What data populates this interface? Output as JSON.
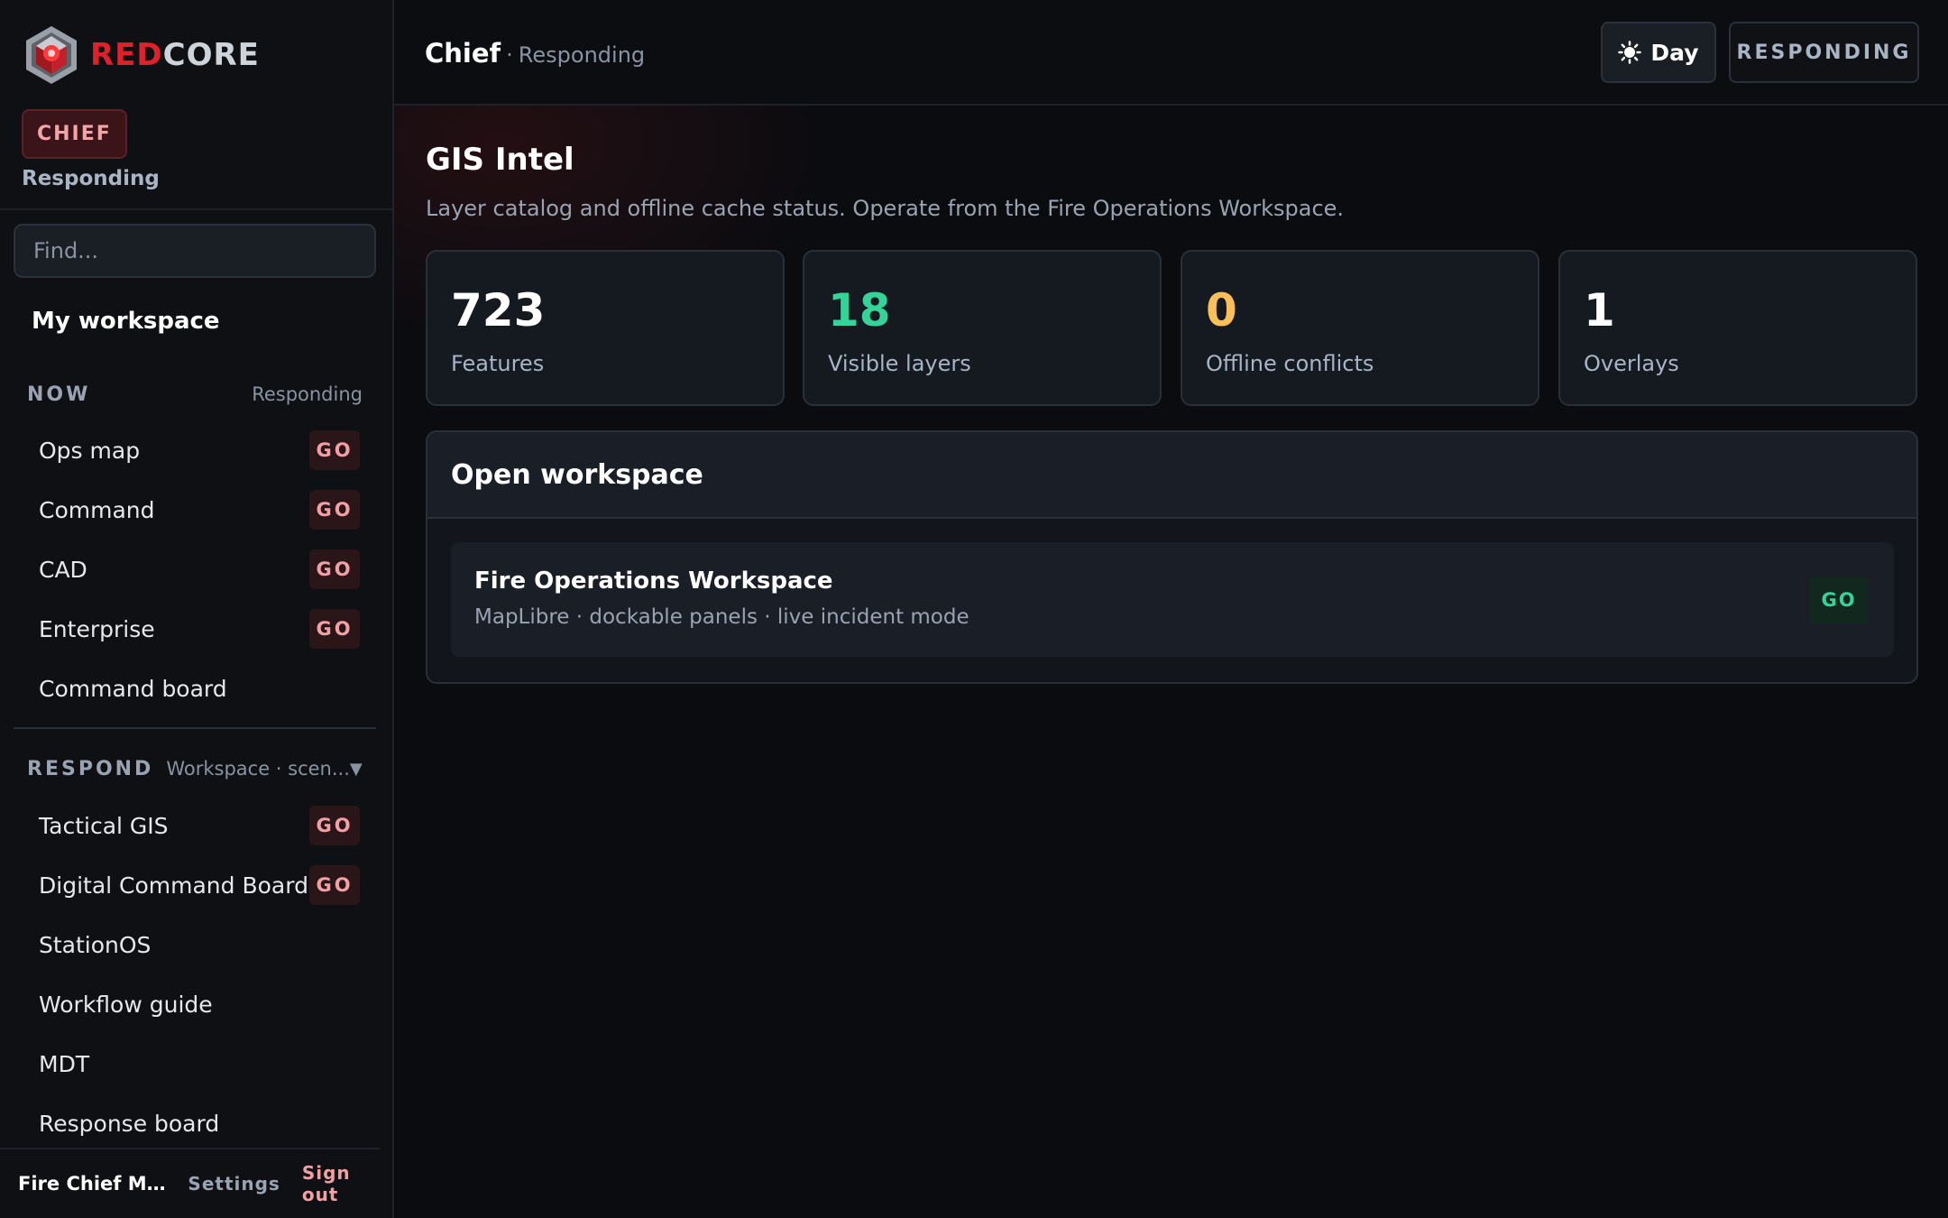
{
  "brand": {
    "name_red": "RED",
    "name_core": "CORE",
    "logo_icon": "redcore-logo-icon"
  },
  "sidebar": {
    "role_badge": "CHIEF",
    "role_status": "Responding",
    "search_placeholder": "Find...",
    "my_workspace": "My workspace",
    "now_section": {
      "label": "NOW",
      "note": "Responding",
      "items": [
        {
          "label": "Ops map",
          "badge": "GO"
        },
        {
          "label": "Command",
          "badge": "GO"
        },
        {
          "label": "CAD",
          "badge": "GO"
        },
        {
          "label": "Enterprise",
          "badge": "GO"
        },
        {
          "label": "Command board"
        }
      ]
    },
    "respond_section": {
      "label": "RESPOND",
      "sub": "Workspace · scen...",
      "caret_icon": "caret-down-icon",
      "items": [
        {
          "label": "Tactical GIS",
          "badge": "GO"
        },
        {
          "label": "Digital Command Board",
          "badge": "GO"
        },
        {
          "label": "StationOS"
        },
        {
          "label": "Workflow guide"
        },
        {
          "label": "MDT"
        },
        {
          "label": "Response board"
        }
      ]
    },
    "footer": {
      "user": "Fire Chief Morg...",
      "settings": "Settings",
      "sign_out": "Sign out"
    }
  },
  "topbar": {
    "role": "Chief",
    "separator": "·",
    "status": "Responding",
    "day_button": "Day",
    "sun_icon": "sun-icon",
    "responding_button": "RESPONDING"
  },
  "main": {
    "title": "GIS Intel",
    "subtitle": "Layer catalog and offline cache status. Operate from the Fire Operations Workspace.",
    "stats": [
      {
        "value": "723",
        "label": "Features",
        "color": "#ffffff"
      },
      {
        "value": "18",
        "label": "Visible layers",
        "color": "#34d399"
      },
      {
        "value": "0",
        "label": "Offline conflicts",
        "color": "#fbbf5a"
      },
      {
        "value": "1",
        "label": "Overlays",
        "color": "#ffffff"
      }
    ],
    "workspace_panel": {
      "title": "Open workspace",
      "item": {
        "title": "Fire Operations Workspace",
        "subtitle": "MapLibre · dockable panels · live incident mode",
        "badge": "GO"
      }
    }
  },
  "colors": {
    "accent_red": "#e0202a",
    "go_green": "#34d399",
    "warning": "#fbbf5a"
  }
}
